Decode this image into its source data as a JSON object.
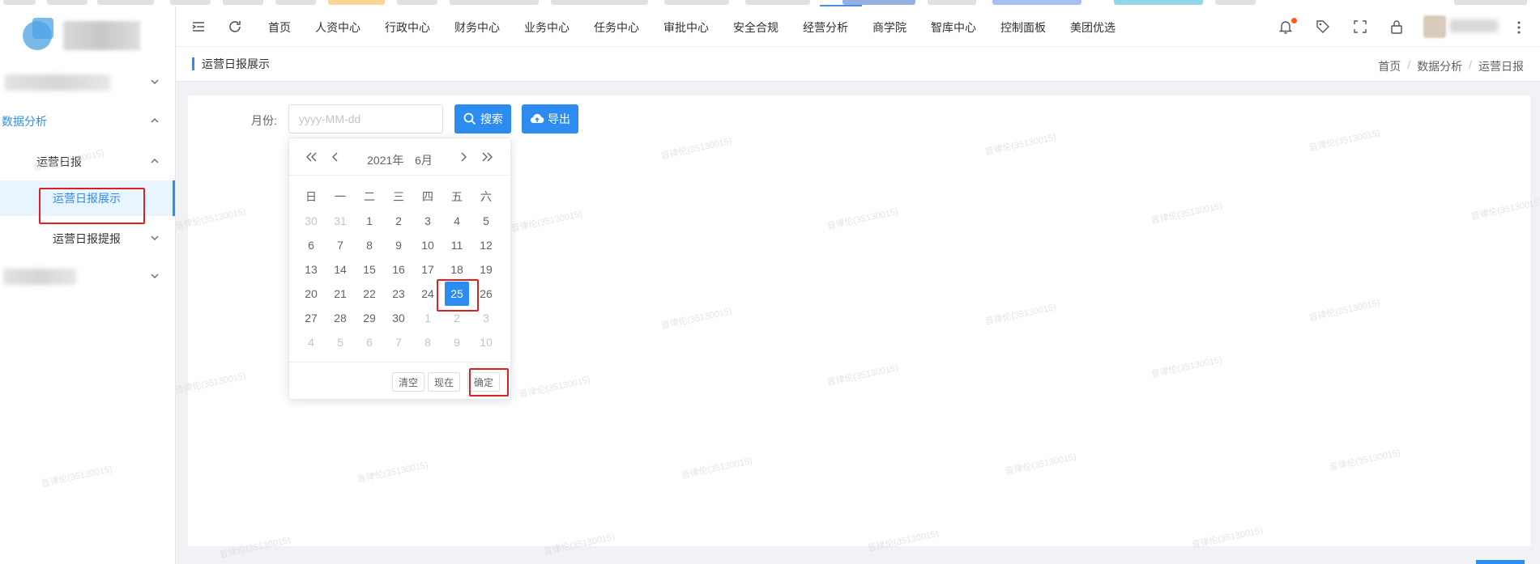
{
  "sidebar": {
    "section_data_analysis": "数据分析",
    "sub_ops_daily": "运营日报",
    "item_ops_daily_display": "运营日报展示",
    "item_ops_daily_submit": "运营日报提报"
  },
  "navbar": {
    "items": [
      "首页",
      "人资中心",
      "行政中心",
      "财务中心",
      "业务中心",
      "任务中心",
      "审批中心",
      "安全合规",
      "经营分析",
      "商学院",
      "智库中心",
      "控制面板",
      "美团优选"
    ]
  },
  "tagbar": {
    "title": "运营日报展示",
    "breadcrumb": [
      "首页",
      "数据分析",
      "运营日报"
    ],
    "separator": "/"
  },
  "form": {
    "month_label": "月份:",
    "date_placeholder": "yyyy-MM-dd",
    "search_label": "搜索",
    "export_label": "导出"
  },
  "datepicker": {
    "year_label": "2021年",
    "month_label": "6月",
    "weekdays": [
      "日",
      "一",
      "二",
      "三",
      "四",
      "五",
      "六"
    ],
    "weeks": [
      [
        "30",
        "31",
        "1",
        "2",
        "3",
        "4",
        "5"
      ],
      [
        "6",
        "7",
        "8",
        "9",
        "10",
        "11",
        "12"
      ],
      [
        "13",
        "14",
        "15",
        "16",
        "17",
        "18",
        "19"
      ],
      [
        "20",
        "21",
        "22",
        "23",
        "24",
        "25",
        "26"
      ],
      [
        "27",
        "28",
        "29",
        "30",
        "1",
        "2",
        "3"
      ],
      [
        "4",
        "5",
        "6",
        "7",
        "8",
        "9",
        "10"
      ]
    ],
    "selected_day": "25",
    "clear_label": "清空",
    "now_label": "现在",
    "confirm_label": "确定"
  },
  "colors": {
    "accent": "#2d8cf0",
    "highlight_box": "#e02020",
    "notification_dot": "#ff5a1f"
  }
}
